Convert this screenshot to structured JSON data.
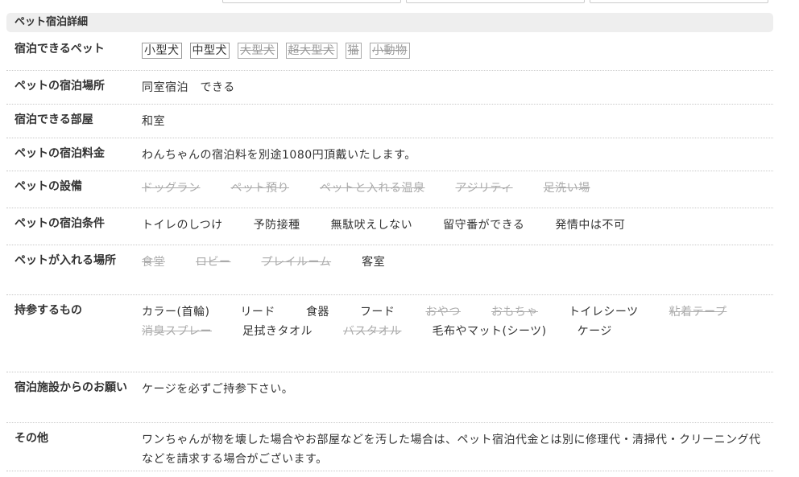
{
  "section_title": "ペット宿泊詳細",
  "rows": [
    {
      "label": "宿泊できるペット",
      "tags": [
        {
          "text": "小型犬",
          "available": true
        },
        {
          "text": "中型犬",
          "available": true
        },
        {
          "text": "大型犬",
          "available": false
        },
        {
          "text": "超大型犬",
          "available": false
        },
        {
          "text": "猫",
          "available": false
        },
        {
          "text": "小動物",
          "available": false
        }
      ]
    },
    {
      "label": "ペットの宿泊場所",
      "items": [
        {
          "text": "同室宿泊　できる",
          "available": true
        }
      ]
    },
    {
      "label": "宿泊できる部屋",
      "items": [
        {
          "text": "和室",
          "available": true
        }
      ]
    },
    {
      "label": "ペットの宿泊料金",
      "text": "わんちゃんの宿泊料を別途1080円頂戴いたします。"
    },
    {
      "label": "ペットの設備",
      "items": [
        {
          "text": "ドッグラン",
          "available": false
        },
        {
          "text": "ペット預り",
          "available": false
        },
        {
          "text": "ペットと入れる温泉",
          "available": false
        },
        {
          "text": "アジリティ",
          "available": false
        },
        {
          "text": "足洗い場",
          "available": false
        }
      ]
    },
    {
      "label": "ペットの宿泊条件",
      "items": [
        {
          "text": "トイレのしつけ",
          "available": true
        },
        {
          "text": "予防接種",
          "available": true
        },
        {
          "text": "無駄吠えしない",
          "available": true
        },
        {
          "text": "留守番ができる",
          "available": true
        },
        {
          "text": "発情中は不可",
          "available": true
        }
      ]
    },
    {
      "label": "ペットが入れる場所",
      "items": [
        {
          "text": "食堂",
          "available": false
        },
        {
          "text": "ロビー",
          "available": false
        },
        {
          "text": "プレイルーム",
          "available": false
        },
        {
          "text": "客室",
          "available": true
        }
      ]
    },
    {
      "label": "持参するもの",
      "items": [
        {
          "text": "カラー(首輪)",
          "available": true
        },
        {
          "text": "リード",
          "available": true
        },
        {
          "text": "食器",
          "available": true
        },
        {
          "text": "フード",
          "available": true
        },
        {
          "text": "おやつ",
          "available": false
        },
        {
          "text": "おもちゃ",
          "available": false
        },
        {
          "text": "トイレシーツ",
          "available": true
        },
        {
          "text": "粘着テープ",
          "available": false
        },
        {
          "text": "消臭スプレー",
          "available": false
        },
        {
          "text": "足拭きタオル",
          "available": true
        },
        {
          "text": "バスタオル",
          "available": false
        },
        {
          "text": "毛布やマット(シーツ)",
          "available": true
        },
        {
          "text": "ケージ",
          "available": true
        }
      ]
    },
    {
      "label": "宿泊施設からのお願い",
      "text": "ケージを必ずご持参下さい。"
    },
    {
      "label": "その他",
      "text": "ワンちゃんが物を壊した場合やお部屋などを汚した場合は、ペット宿泊代金とは別に修理代・清掃代・クリーニング代などを請求する場合がございます。"
    }
  ]
}
